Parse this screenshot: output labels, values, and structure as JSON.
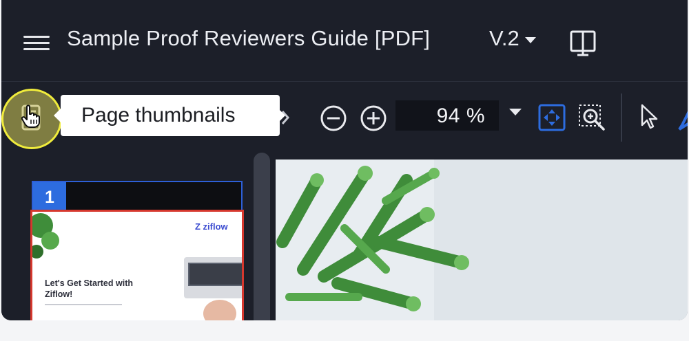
{
  "header": {
    "title": "Sample Proof Reviewers Guide [PDF]",
    "version": "V.2"
  },
  "toolbar": {
    "tooltip": "Page thumbnails",
    "zoom_value": "94 %"
  },
  "sidebar": {
    "page_number": "1",
    "thumbnail": {
      "logo_text": "Z ziflow",
      "headline": "Let's Get Started with Ziflow!"
    }
  },
  "colors": {
    "background": "#1c1f29",
    "accent_blue": "#2d6cdf",
    "highlight_yellow": "#f0ec3c",
    "selection_red": "#d6382e"
  },
  "icons": [
    "menu-icon",
    "chevron-down-icon",
    "compare-view-icon",
    "page-thumbnails-icon",
    "hand-pointer-icon",
    "zoom-out-icon",
    "zoom-in-icon",
    "fit-to-screen-icon",
    "zoom-area-icon",
    "select-arrow-icon"
  ]
}
